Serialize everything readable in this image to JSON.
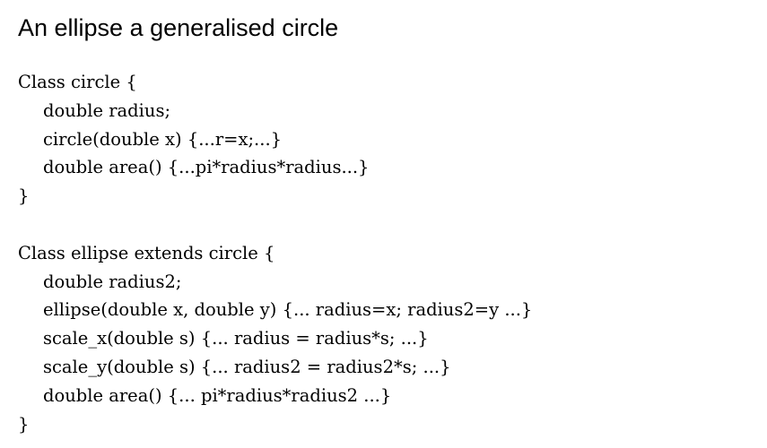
{
  "slide": {
    "title": "An ellipse a generalised circle",
    "code": {
      "line1": "Class circle {",
      "line2": "double radius;",
      "line3": "circle(double x) {...r=x;...}",
      "line4": "double area() {...pi*radius*radius...}",
      "line5": "}",
      "line6": "Class ellipse extends circle {",
      "line7": "double radius2;",
      "line8": "ellipse(double x, double y) {... radius=x; radius2=y ...}",
      "line9": "scale_x(double s) {... radius = radius*s; ...}",
      "line10": "scale_y(double s) {... radius2 = radius2*s; ...}",
      "line11": "double area() {... pi*radius*radius2 ...}",
      "line12": "}"
    }
  }
}
